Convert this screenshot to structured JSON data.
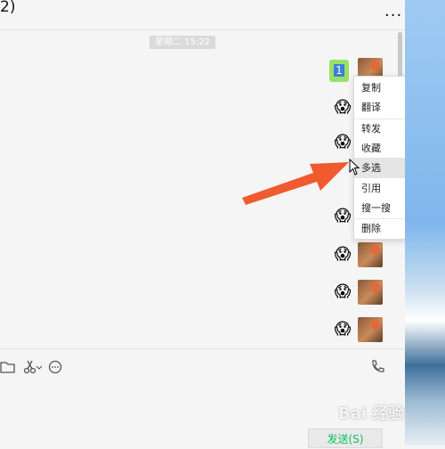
{
  "header": {
    "title": "2)",
    "more_label": "..."
  },
  "chat": {
    "timestamp": "星期二 15:22",
    "sent_text": "1"
  },
  "context_menu": {
    "items": [
      {
        "label": "复制"
      },
      {
        "label": "翻译"
      },
      {
        "label": "转发"
      },
      {
        "label": "收藏"
      },
      {
        "label": "多选"
      },
      {
        "label": "引用"
      },
      {
        "label": "搜一搜"
      },
      {
        "label": "删除"
      }
    ],
    "hovered_index": 4
  },
  "input": {
    "send_label": "发送(S)"
  },
  "icons": [
    "folder-icon",
    "scissors-icon",
    "chat-bubble-icon",
    "phone-icon",
    "chevron-down-icon"
  ],
  "watermark": "Bai 经验",
  "colors": {
    "arrow": "#ef5a2e",
    "send_text": "#07c160",
    "bubble": "#98e165"
  }
}
